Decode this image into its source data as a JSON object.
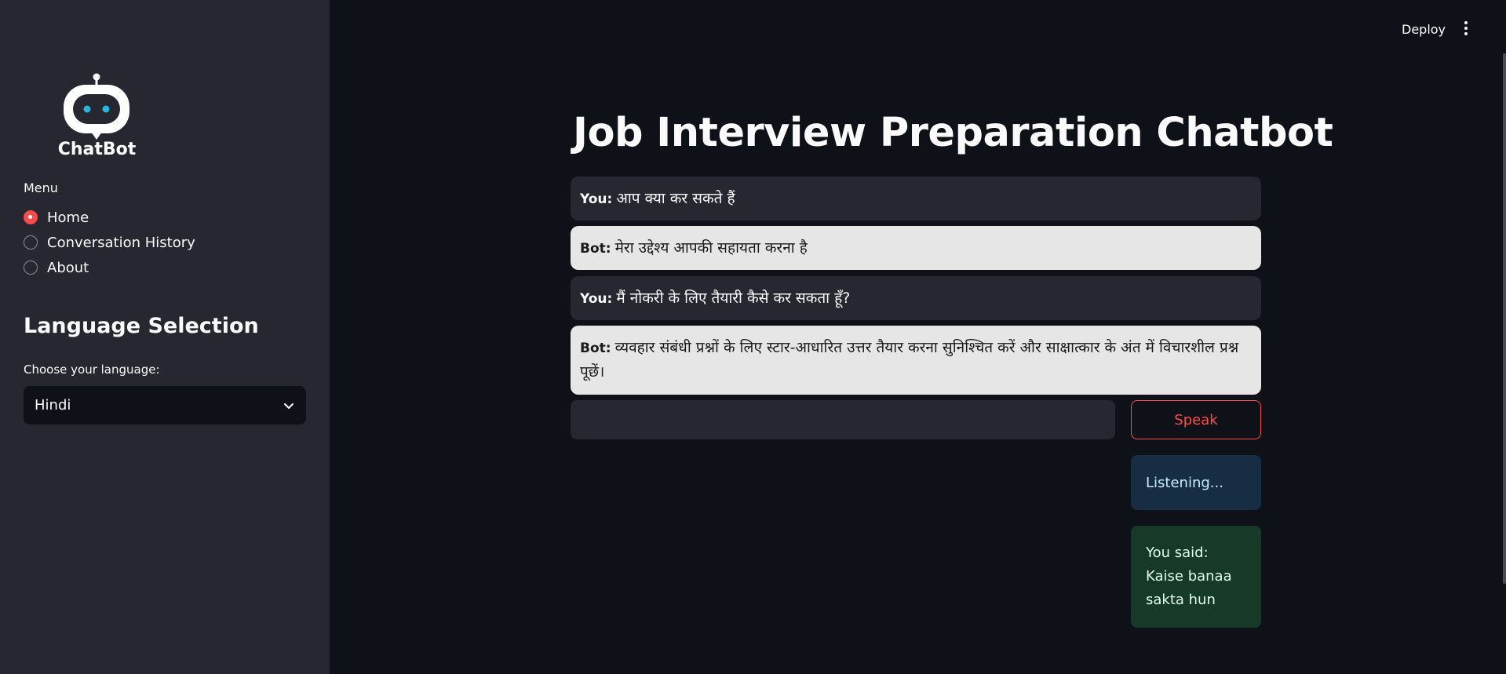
{
  "header": {
    "deploy_label": "Deploy",
    "menu_icon": "kebab-menu-icon"
  },
  "sidebar": {
    "logo_text": "ChatBot",
    "menu_label": "Menu",
    "menu_items": [
      {
        "label": "Home",
        "selected": true
      },
      {
        "label": "Conversation History",
        "selected": false
      },
      {
        "label": "About",
        "selected": false
      }
    ],
    "language_title": "Language Selection",
    "language_label": "Choose your language:",
    "language_value": "Hindi"
  },
  "main": {
    "title": "Job Interview Preparation Chatbot",
    "messages": [
      {
        "role": "You:",
        "text": "आप क्या कर सकते हैं"
      },
      {
        "role": "Bot:",
        "text": "मेरा उद्देश्य आपकी सहायता करना है"
      },
      {
        "role": "You:",
        "text": "मैं नोकरी के लिए तैयारी कैसे कर सकता हूँ?"
      },
      {
        "role": "Bot:",
        "text": "व्यवहार संबंधी प्रश्नों के लिए स्टार-आधारित उत्तर तैयार करना सुनिश्चित करें और साक्षात्कार के अंत में विचारशील प्रश्न पूछें।"
      }
    ],
    "input_value": "",
    "speak_label": "Speak",
    "status_listening": "Listening...",
    "status_said": "You said: Kaise banaa sakta hun"
  },
  "colors": {
    "background": "#0e1117",
    "sidebar": "#262730",
    "accent": "#ff4b4b",
    "user_bubble": "#262730",
    "bot_bubble": "#e6e6e6",
    "info_bg": "#172d43",
    "success_bg": "#173928"
  }
}
